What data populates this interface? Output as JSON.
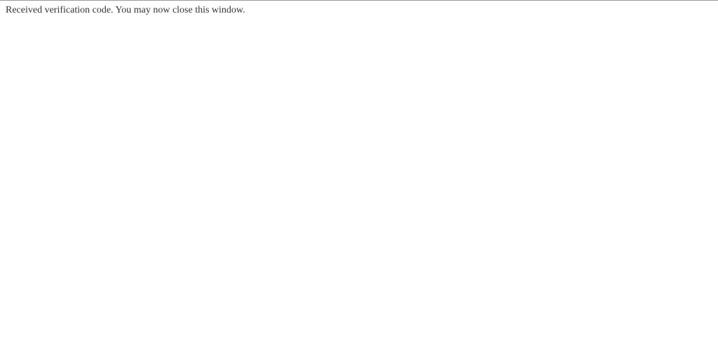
{
  "main": {
    "message": "Received verification code. You may now close this window."
  }
}
